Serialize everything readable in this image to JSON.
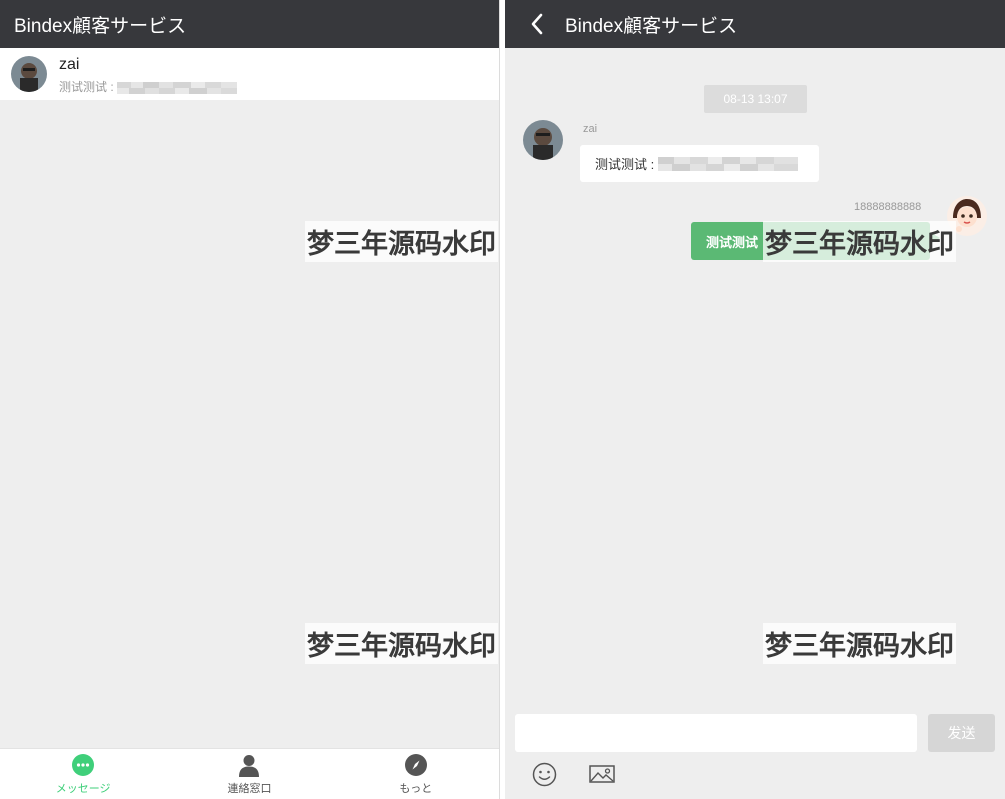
{
  "left": {
    "title": "Bindex顧客サービス",
    "conversation": {
      "name": "zai",
      "preview": "测试测试 :"
    },
    "watermark_top": "梦三年源码水印",
    "watermark_bottom": "梦三年源码水印",
    "tabs": [
      {
        "label": "メッセージ",
        "icon": "chat-bubble-icon",
        "active": true
      },
      {
        "label": "連絡窓口",
        "icon": "person-icon",
        "active": false
      },
      {
        "label": "もっと",
        "icon": "compass-icon",
        "active": false
      }
    ]
  },
  "right": {
    "title": "Bindex顧客サービス",
    "timestamp": "08-13 13:07",
    "incoming": {
      "sender": "zai",
      "text": "测试测试 :"
    },
    "outgoing": {
      "sender": "18888888888",
      "text": "测试测试"
    },
    "watermark_top": "梦三年源码水印",
    "watermark_bottom": "梦三年源码水印",
    "input_placeholder": "",
    "send_label": "发送"
  },
  "colors": {
    "header": "#37383c",
    "background": "#eeeeee",
    "accent_green": "#3fcf7a",
    "bubble_green": "#5bb974"
  }
}
